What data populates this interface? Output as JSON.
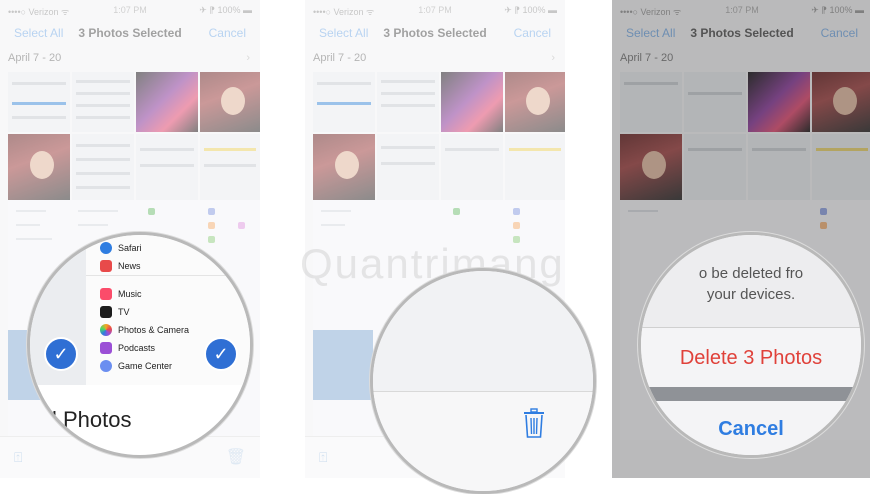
{
  "status_bar": {
    "carrier": "••••○ Verizon ᯤ",
    "time": "1:07 PM",
    "battery": "✈ ⁋ 100% ▬"
  },
  "nav": {
    "left": "Select All",
    "title": "3 Photos Selected",
    "right": "Cancel"
  },
  "section": {
    "date_range": "April 7 - 20",
    "chevron": "›"
  },
  "lens1": {
    "share_items": [
      {
        "label": "Safari",
        "color": "#2f7de1"
      },
      {
        "label": "News",
        "color": "#e84a4a"
      },
      {
        "label": "Music",
        "color": "#fb4c6a"
      },
      {
        "label": "TV",
        "color": "#1c1c1c"
      },
      {
        "label": "Photos & Camera",
        "color": "#f5a623"
      },
      {
        "label": "Podcasts",
        "color": "#9b4fd6"
      },
      {
        "label": "Game Center",
        "color": "#6b8ef0"
      }
    ],
    "caption": "l Photos"
  },
  "lens3": {
    "message_line1": "o be deleted fro",
    "message_line2": "your devices.",
    "delete_label": "Delete 3 Photos",
    "cancel_label": "Cancel"
  },
  "icons": {
    "check": "✓",
    "share": "⍐",
    "trash": "🗑"
  },
  "colors": {
    "accent": "#2f7de1",
    "destructive": "#e0413a",
    "check_blue": "#2f6fd4"
  }
}
